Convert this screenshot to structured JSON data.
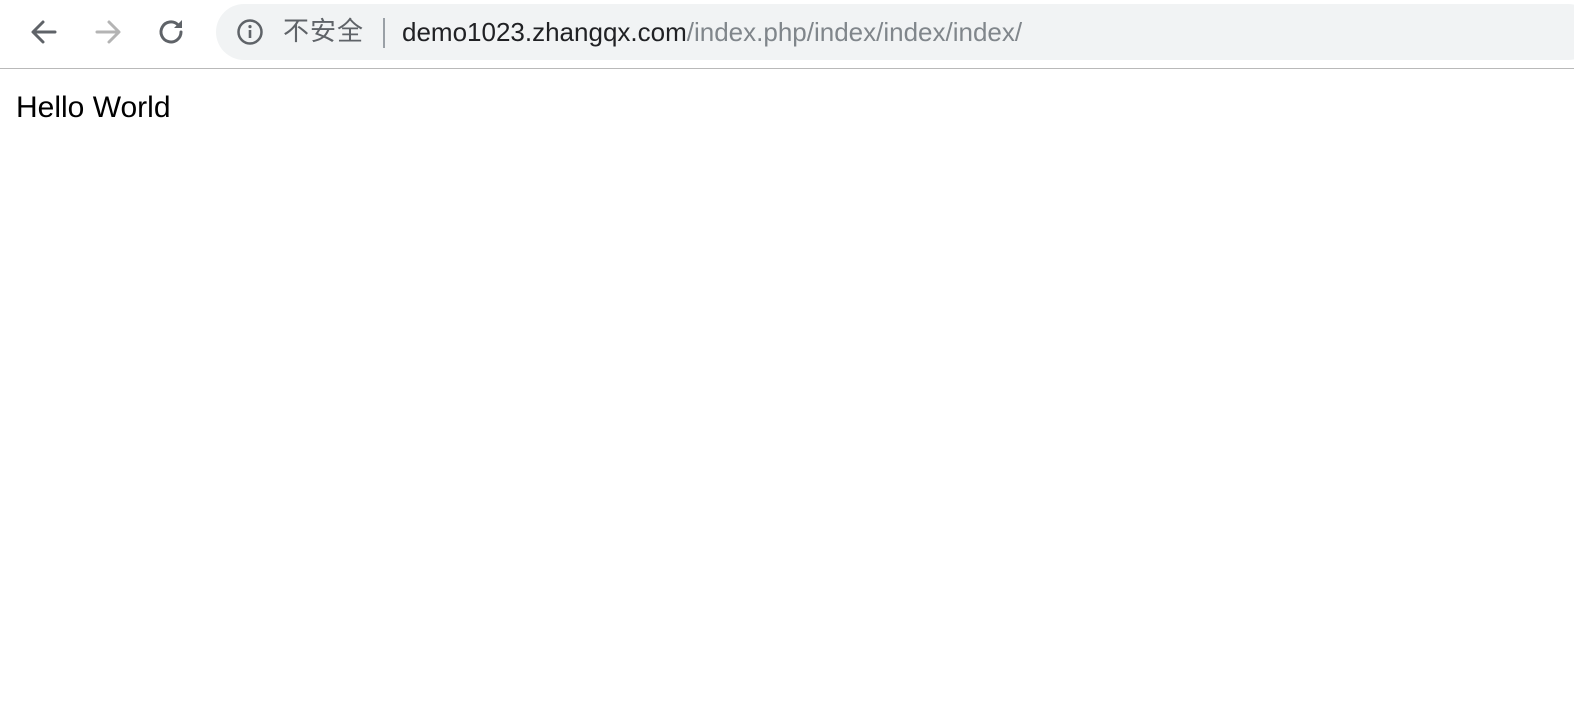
{
  "browser": {
    "nav": {
      "back_icon": "arrow-left-icon",
      "forward_icon": "arrow-right-icon",
      "reload_icon": "reload-icon"
    },
    "omnibox": {
      "info_icon": "info-circle-icon",
      "security_label": "不安全",
      "url_host": "demo1023.zhangqx.com",
      "url_path": "/index.php/index/index/index/"
    },
    "colors": {
      "omnibox_bg": "#f1f3f4",
      "icon_active": "#5f6368",
      "icon_disabled": "#b4b4b4"
    }
  },
  "page": {
    "body_text": "Hello World"
  }
}
